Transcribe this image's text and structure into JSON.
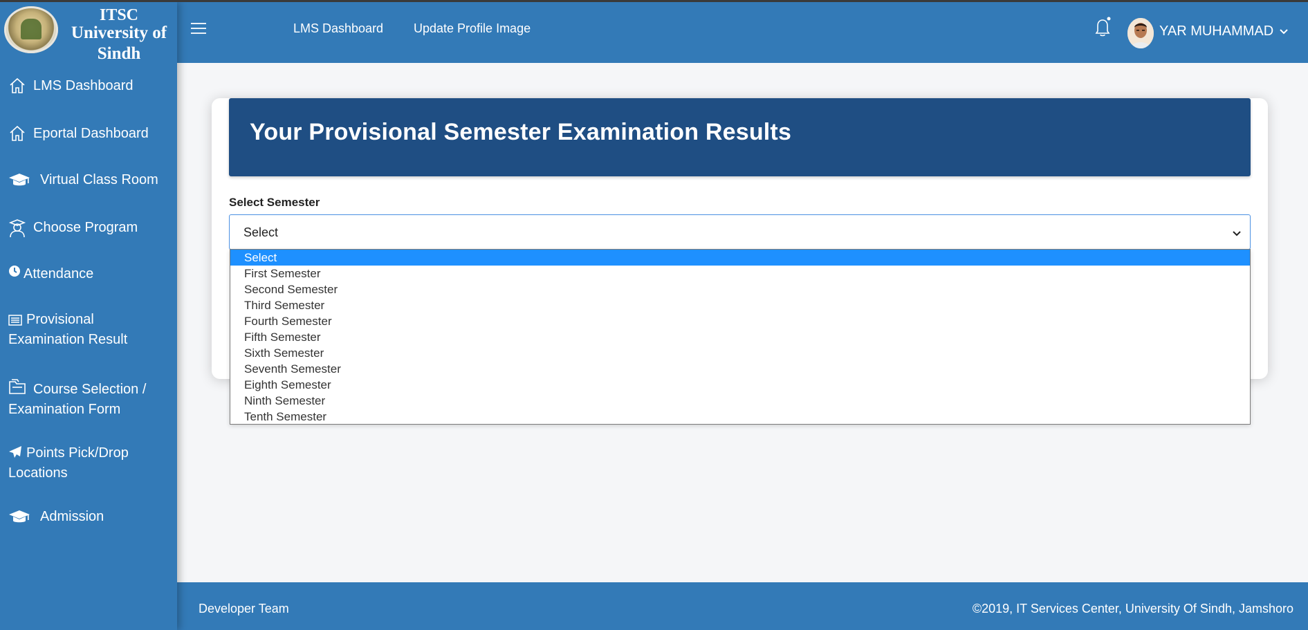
{
  "logo": {
    "line1": "ITSC",
    "line2": "University of Sindh"
  },
  "sidebar": {
    "items": [
      {
        "label": "LMS Dashboard",
        "icon": "home-icon"
      },
      {
        "label": "Eportal Dashboard",
        "icon": "home-icon"
      },
      {
        "label": "Virtual Class Room",
        "icon": "graduation-cap-icon"
      },
      {
        "label": "Choose Program",
        "icon": "user-graduate-icon"
      },
      {
        "label": "Attendance",
        "icon": "clock-icon"
      },
      {
        "label": "Provisional Examination Result",
        "icon": "list-alt-icon"
      },
      {
        "label": "Course Selection / Examination Form",
        "icon": "folder-icon"
      },
      {
        "label": "Points Pick/Drop Locations",
        "icon": "paper-plane-icon"
      },
      {
        "label": "Admission",
        "icon": "graduation-cap-icon"
      }
    ]
  },
  "header": {
    "links": [
      "LMS Dashboard",
      "Update Profile Image"
    ],
    "user_name": "YAR MUHAMMAD"
  },
  "main": {
    "title": "Your Provisional Semester Examination Results",
    "select_label": "Select Semester",
    "select_value": "Select",
    "options": [
      "Select",
      "First Semester",
      "Second Semester",
      "Third Semester",
      "Fourth Semester",
      "Fifth Semester",
      "Sixth Semester",
      "Seventh Semester",
      "Eighth Semester",
      "Ninth Semester",
      "Tenth Semester"
    ],
    "highlighted_option": "Select"
  },
  "footer": {
    "left": "Developer Team",
    "right": "©2019, IT Services Center, University Of Sindh, Jamshoro"
  },
  "colors": {
    "primary": "#337ab7",
    "banner": "#1f4e83",
    "highlight": "#1e90ff"
  }
}
